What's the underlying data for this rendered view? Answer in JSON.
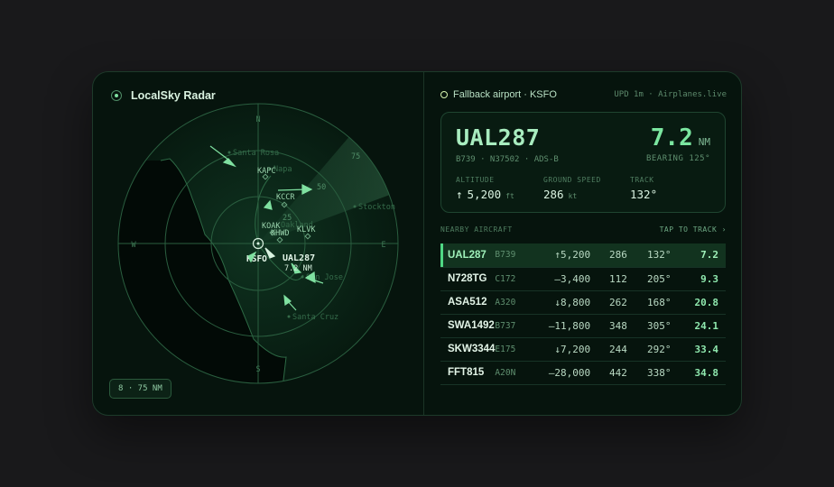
{
  "app": {
    "title": "LocalSky Radar"
  },
  "radar": {
    "compass": {
      "n": "N",
      "e": "E",
      "s": "S",
      "w": "W"
    },
    "range_rings": [
      "25",
      "50",
      "75"
    ],
    "range_chip": "8 · 75 NM",
    "places": [
      "Santa Rosa",
      "Napa",
      "Stockton",
      "Oakland",
      "San Jose",
      "Santa Cruz"
    ],
    "airports": [
      "KAPC",
      "KCCR",
      "KOAK",
      "KHWD",
      "KLVK",
      "KSFO"
    ],
    "home_label": "KSFO",
    "selected_label": "UAL287",
    "selected_dist_label": "7.2 NM"
  },
  "header": {
    "fallback": "Fallback airport · KSFO",
    "updated": "UPD 1m · Airplanes.live"
  },
  "selected": {
    "callsign": "UAL287",
    "meta": "B739 · N37502 · ADS-B",
    "distance": "7.2",
    "distance_unit": "NM",
    "bearing": "BEARING 125°",
    "altitude_label": "ALTITUDE",
    "altitude_arrow": "↑",
    "altitude_value": "5,200",
    "altitude_unit": "ft",
    "speed_label": "GROUND SPEED",
    "speed_value": "286",
    "speed_unit": "kt",
    "track_label": "TRACK",
    "track_value": "132°"
  },
  "list": {
    "title": "NEARBY AIRCRAFT",
    "action": "TAP TO TRACK ›",
    "rows": [
      {
        "callsign": "UAL287",
        "type": "B739",
        "alt": "↑5,200",
        "gs": "286",
        "track": "132°",
        "dist": "7.2",
        "selected": true
      },
      {
        "callsign": "N728TG",
        "type": "C172",
        "alt": "—3,400",
        "gs": "112",
        "track": "205°",
        "dist": "9.3",
        "selected": false
      },
      {
        "callsign": "ASA512",
        "type": "A320",
        "alt": "↓8,800",
        "gs": "262",
        "track": "168°",
        "dist": "20.8",
        "selected": false
      },
      {
        "callsign": "SWA1492",
        "type": "B737",
        "alt": "—11,800",
        "gs": "348",
        "track": "305°",
        "dist": "24.1",
        "selected": false
      },
      {
        "callsign": "SKW3344",
        "type": "E175",
        "alt": "↓7,200",
        "gs": "244",
        "track": "292°",
        "dist": "33.4",
        "selected": false
      },
      {
        "callsign": "FFT815",
        "type": "A20N",
        "alt": "—28,000",
        "gs": "442",
        "track": "338°",
        "dist": "34.8",
        "selected": false
      }
    ]
  }
}
